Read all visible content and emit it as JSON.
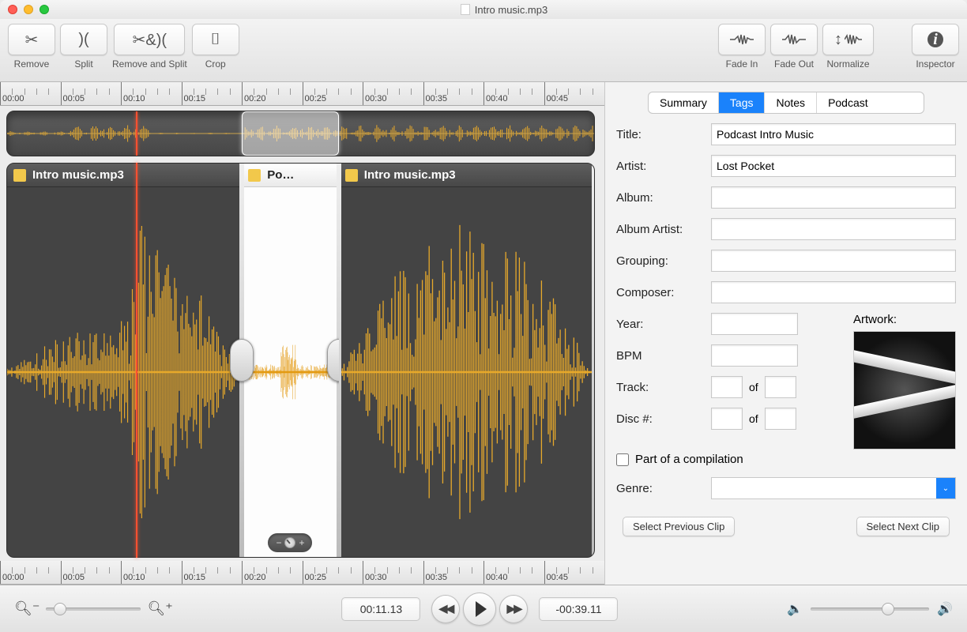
{
  "window": {
    "title": "Intro music.mp3"
  },
  "toolbar": {
    "remove": "Remove",
    "split": "Split",
    "remove_split": "Remove and Split",
    "crop": "Crop",
    "fade_in": "Fade In",
    "fade_out": "Fade Out",
    "normalize": "Normalize",
    "inspector": "Inspector"
  },
  "ruler": {
    "marks": [
      "00:00",
      "00:05",
      "00:10",
      "00:15",
      "00:20",
      "00:25",
      "00:30",
      "00:35",
      "00:40",
      "00:45"
    ]
  },
  "playhead_pct": 22.0,
  "overview_sel": {
    "left_pct": 40.0,
    "width_pct": 16.5
  },
  "clips": [
    {
      "title": "Intro music.mp3",
      "left_pct": 0,
      "width_pct": 40,
      "selected": false
    },
    {
      "title": "Po…",
      "left_pct": 40,
      "width_pct": 16.5,
      "selected": true
    },
    {
      "title": "Intro music.mp3",
      "left_pct": 56.5,
      "width_pct": 43.5,
      "selected": false
    }
  ],
  "inspector": {
    "tabs": {
      "summary": "Summary",
      "tags": "Tags",
      "notes": "Notes",
      "podcast": "Podcast",
      "active": "tags"
    },
    "fields": {
      "title_label": "Title:",
      "title": "Podcast Intro Music",
      "artist_label": "Artist:",
      "artist": "Lost Pocket",
      "album_label": "Album:",
      "album": "",
      "album_artist_label": "Album Artist:",
      "album_artist": "",
      "grouping_label": "Grouping:",
      "grouping": "",
      "composer_label": "Composer:",
      "composer": "",
      "year_label": "Year:",
      "year": "",
      "bpm_label": "BPM",
      "bpm": "",
      "track_label": "Track:",
      "track_n": "",
      "track_of": "",
      "disc_label": "Disc #:",
      "disc_n": "",
      "disc_of": "",
      "of_text": "of",
      "artwork_label": "Artwork:",
      "compilation_label": "Part of a compilation",
      "compilation_checked": false,
      "genre_label": "Genre:",
      "genre": ""
    },
    "nav": {
      "prev": "Select Previous Clip",
      "next": "Select Next Clip"
    }
  },
  "transport": {
    "elapsed": "00:11.13",
    "remaining": "-00:39.11",
    "zoom_pct": 8,
    "volume_pct": 60
  }
}
